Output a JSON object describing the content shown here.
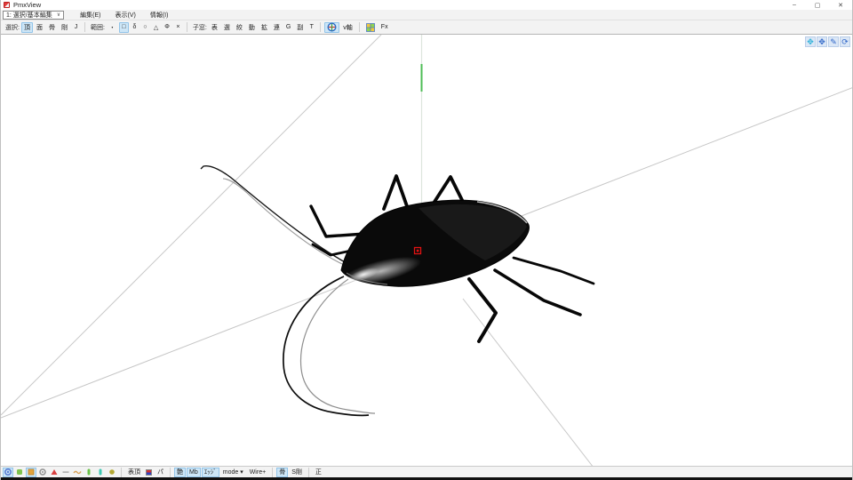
{
  "window": {
    "title": "PmxView",
    "minimize": "–",
    "restore": "▢",
    "close": "✕"
  },
  "menubar": {
    "mode_combo": {
      "value": "1: 選択/基本編集",
      "arrow": "∨"
    },
    "edit": "編集(E)",
    "view": "表示(V)",
    "info": "情報(I)"
  },
  "toolbar": {
    "select_label": "選択:",
    "select_buttons": [
      {
        "label": "頂",
        "active": true
      },
      {
        "label": "面",
        "active": false
      },
      {
        "label": "骨",
        "active": false
      },
      {
        "label": "剛",
        "active": false
      },
      {
        "label": "J",
        "active": false
      }
    ],
    "range_label": "範囲:",
    "range_buttons": [
      {
        "label": "・",
        "active": false
      },
      {
        "label": "□",
        "active": true
      },
      {
        "label": "δ",
        "active": false
      },
      {
        "label": "○",
        "active": false
      },
      {
        "label": "△",
        "active": false
      },
      {
        "label": "Φ",
        "active": false
      },
      {
        "label": "×",
        "active": false
      }
    ],
    "child_label": "子窓:",
    "child_buttons": [
      "表",
      "選",
      "絞",
      "動",
      "拡",
      "連",
      "G",
      "副",
      "T"
    ],
    "vaxis": "v軸",
    "fx": "Fx"
  },
  "bottombar": {
    "show_front": "表頂",
    "perspective": "パ",
    "gloss": "艶",
    "mb": "Mb",
    "edge": "ｴｯｼﾞ",
    "mode": "mode ▾",
    "wire": "Wire+",
    "bone": "骨",
    "s_rigid": "S剛",
    "ortho": "正"
  },
  "colors": {
    "selection_accent": "#cde6f7",
    "y_axis_green": "#4fbe57",
    "grid_line_gray": "#c6c6c6",
    "marker_red": "#e31212"
  }
}
